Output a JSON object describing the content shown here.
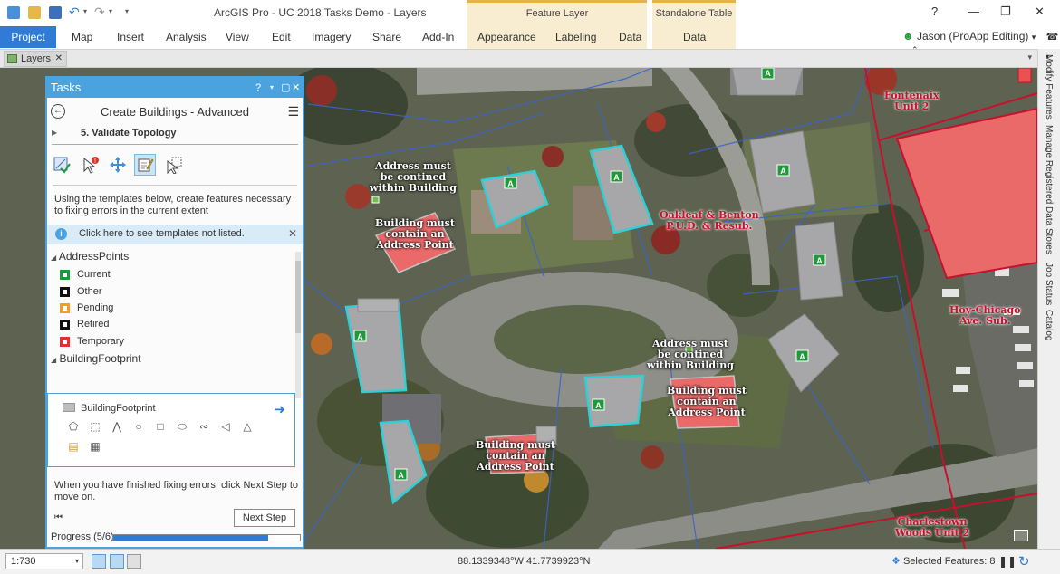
{
  "window": {
    "title": "ArcGIS Pro - UC 2018 Tasks Demo - Layers",
    "context_groups": [
      {
        "name": "Feature Layer",
        "tabs": [
          "Appearance",
          "Labeling",
          "Data"
        ]
      },
      {
        "name": "Standalone Table",
        "tabs": [
          "Data"
        ]
      }
    ],
    "help": "?",
    "minimize": "—",
    "restore": "❐",
    "close": "✕"
  },
  "ribbon": {
    "project": "Project",
    "tabs": [
      "Map",
      "Insert",
      "Analysis",
      "View",
      "Edit",
      "Imagery",
      "Share",
      "Add-In"
    ],
    "user": "Jason (ProApp Editing)",
    "user_menu": "▾"
  },
  "doc_tab": {
    "label": "Layers",
    "close": "✕"
  },
  "tasks": {
    "pane_title": "Tasks",
    "pane_help": "?",
    "pane_pin": "⬆",
    "pane_auto": "▢",
    "pane_close": "✕",
    "task_title": "Create Buildings - Advanced",
    "step_label": "5.  Validate Topology",
    "instruction": "Using the templates below, create features necessary to fixing errors in the current extent",
    "info_bar": "Click here to see templates not listed.",
    "groups": [
      {
        "name": "AddressPoints",
        "items": [
          {
            "label": "Current",
            "color": "#1f9a3a"
          },
          {
            "label": "Other",
            "color": "#111111"
          },
          {
            "label": "Pending",
            "color": "#f0a020"
          },
          {
            "label": "Retired",
            "color": "#111111"
          },
          {
            "label": "Temporary",
            "color": "#e03030"
          }
        ]
      },
      {
        "name": "BuildingFootprint",
        "items": []
      }
    ],
    "building_template": {
      "label": "BuildingFootprint"
    },
    "finish_text": "When you have finished fixing errors, click Next Step to move on.",
    "next_button": "Next Step",
    "progress_label": "Progress (5/6)",
    "progress_fraction": 0.83
  },
  "map": {
    "labels": [
      {
        "text": "Address must\nbe contined\nwithin Building",
        "style": "white"
      },
      {
        "text": "Building must\ncontain an\nAddress Point",
        "style": "white"
      },
      {
        "text": "Oakleaf & Benton\nP.U.D. & Resub.",
        "style": "red"
      },
      {
        "text": "Fontenaix\nUnit 2",
        "style": "red"
      },
      {
        "text": "Hoy-Chicago\nAve. Sub.",
        "style": "red"
      },
      {
        "text": "Address must\nbe contined\nwithin Building",
        "style": "white"
      },
      {
        "text": "Building must\ncontain an\nAddress Point",
        "style": "white"
      },
      {
        "text": "Building must\ncontain an\nAddress Point",
        "style": "white"
      },
      {
        "text": "Charlestown\nWoods Unit 2",
        "style": "red"
      }
    ],
    "point_marker": "A"
  },
  "right_dock": [
    "Modify Features",
    "Manage Registered Data Stores",
    "Job Status",
    "Catalog"
  ],
  "status": {
    "scale": "1:730",
    "coordinates": "88.1339348°W 41.7739923°N",
    "selected_features": "Selected Features: 8",
    "pause": "❚❚"
  }
}
